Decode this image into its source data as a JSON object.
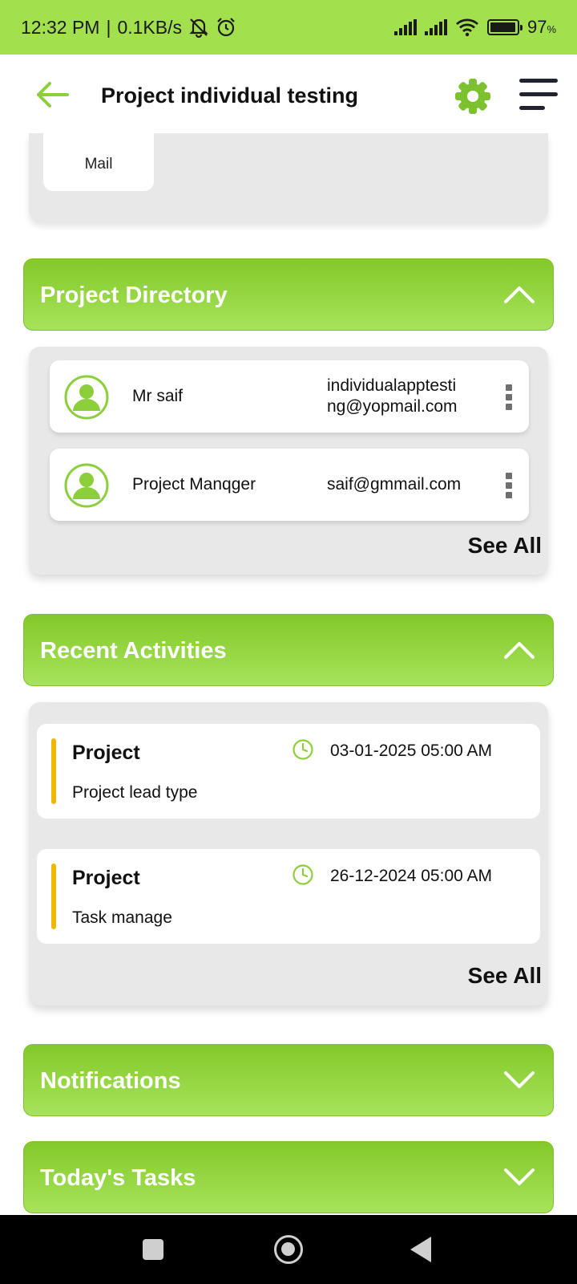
{
  "status_bar": {
    "time": "12:32 PM",
    "separator": "|",
    "speed": "0.1KB/s",
    "battery_percent": "97",
    "battery_unit": "%",
    "battery_level": 0.97
  },
  "header": {
    "title": "Project individual testing",
    "back_icon": "arrow-left-icon",
    "settings_icon": "gear-icon",
    "menu_icon": "hamburger-menu-icon"
  },
  "top_card": {
    "mail_label": "Mail"
  },
  "project_directory": {
    "title": "Project Directory",
    "expanded": true,
    "contacts": [
      {
        "name": "Mr saif",
        "email": "individualapptesting@yopmail.com"
      },
      {
        "name": "Project Manqger",
        "email": "saif@gmmail.com"
      }
    ],
    "see_all": "See All"
  },
  "recent_activities": {
    "title": "Recent Activities",
    "expanded": true,
    "items": [
      {
        "title": "Project",
        "subtitle": "Project lead type",
        "datetime": "03-01-2025 05:00 AM"
      },
      {
        "title": "Project",
        "subtitle": "Task manage",
        "datetime": "26-12-2024 05:00 AM"
      }
    ],
    "see_all": "See All"
  },
  "notifications": {
    "title": "Notifications",
    "expanded": false
  },
  "todays_tasks": {
    "title": "Today's Tasks",
    "expanded": false
  },
  "colors": {
    "status_bar": "#a2e14d",
    "accent_green": "#8ccf3a",
    "activity_bar": "#f2b705"
  }
}
